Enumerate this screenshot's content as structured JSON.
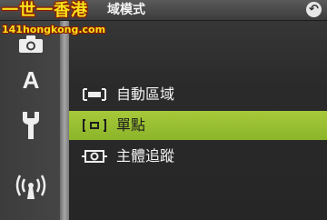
{
  "header": {
    "title": "域模式",
    "back_icon": "back-arrow-icon"
  },
  "watermark": {
    "line1": "一世一香港",
    "line2": "141hongkong.com"
  },
  "sidebar": {
    "tabs": [
      {
        "icon": "camera-icon"
      },
      {
        "label": "A",
        "icon": "auto-mode-icon"
      },
      {
        "icon": "wrench-icon"
      },
      {
        "icon": "wireless-icon"
      }
    ]
  },
  "menu": {
    "items": [
      {
        "label": "自動區域",
        "icon": "auto-area-icon",
        "selected": false
      },
      {
        "label": "單點",
        "icon": "single-point-icon",
        "selected": true
      },
      {
        "label": "主體追蹤",
        "icon": "subject-tracking-icon",
        "selected": false
      }
    ],
    "selected_color": "#9ac036"
  }
}
